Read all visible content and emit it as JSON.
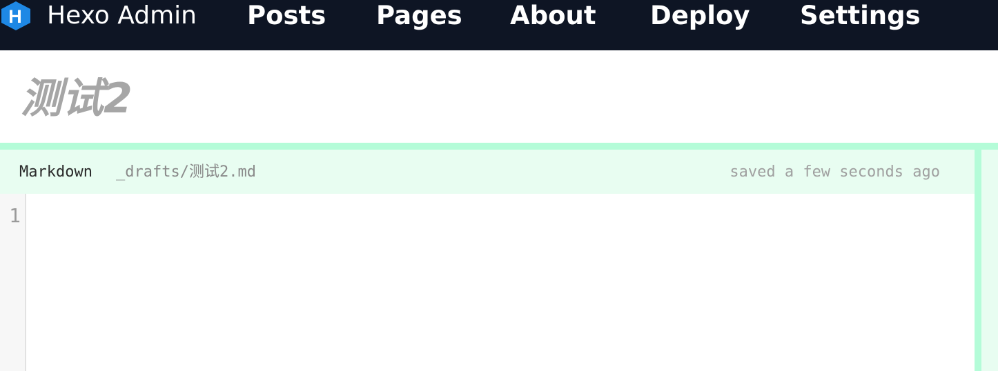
{
  "navbar": {
    "brand": "Hexo Admin",
    "logo_letter": "H",
    "links": {
      "posts": "Posts",
      "pages": "Pages",
      "about": "About",
      "deploy": "Deploy",
      "settings": "Settings"
    }
  },
  "post": {
    "title": "测试2"
  },
  "editor": {
    "mode": "Markdown",
    "path": "_drafts/测试2.md",
    "status": "saved a few seconds ago",
    "line_numbers": [
      "1"
    ],
    "content": ""
  },
  "colors": {
    "navbar_bg": "#0e1524",
    "logo_blue": "#1e88e5",
    "accent_green": "#b4fcd8",
    "header_green": "#e8fdf1",
    "title_gray": "#a6a6a6"
  }
}
